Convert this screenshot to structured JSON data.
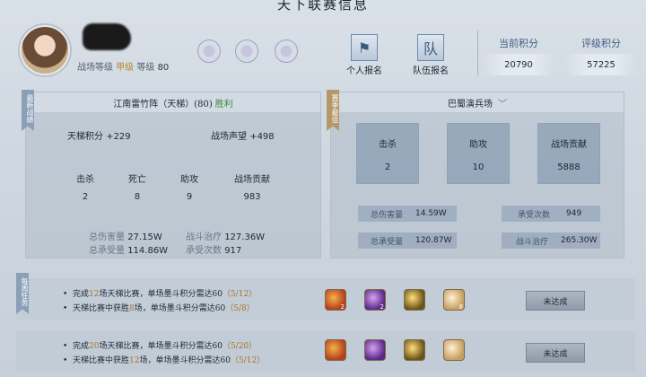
{
  "page_title": "天下联赛信息",
  "profile": {
    "level_label": "战场等级",
    "grade": "甲级",
    "level_word": "等级",
    "level": "80"
  },
  "actions": {
    "personal_signup": "个人报名",
    "team_signup": "队伍报名",
    "team_icon_char": "队"
  },
  "scores": {
    "current_label": "当前积分",
    "current_value": "20790",
    "rating_label": "评级积分",
    "rating_value": "57225"
  },
  "latest_battle": {
    "ribbon": "最新战绩",
    "title": "江南雷竹阵（天梯）(80)",
    "result": "胜利",
    "ladder_label": "天梯积分",
    "ladder_value": "+229",
    "prestige_label": "战场声望",
    "prestige_value": "+498",
    "stats": [
      {
        "label": "击杀",
        "value": "2"
      },
      {
        "label": "死亡",
        "value": "8"
      },
      {
        "label": "助攻",
        "value": "9"
      },
      {
        "label": "战场贡献",
        "value": "983"
      }
    ],
    "damage_label": "总伤害量",
    "damage_value": "27.15W",
    "heal_label": "战斗治疗",
    "heal_value": "127.36W",
    "taken_label": "总承受量",
    "taken_value": "114.86W",
    "hits_label": "承受次数",
    "hits_value": "917"
  },
  "season_best": {
    "ribbon": "赛季最佳",
    "map_name": "巴蜀演兵场",
    "cards": [
      {
        "label": "击杀",
        "value": "2"
      },
      {
        "label": "助攻",
        "value": "10"
      },
      {
        "label": "战场贡献",
        "value": "5888"
      }
    ],
    "damage_label": "总伤害量",
    "damage_value": "14.59W",
    "hits_label": "承受次数",
    "hits_value": "949",
    "taken_label": "总承受量",
    "taken_value": "120.87W",
    "heal_label": "战斗治疗",
    "heal_value": "265.30W"
  },
  "tasks": {
    "ribbon": "每周任务",
    "groups": [
      {
        "line1_pre": "完成",
        "line1_hl": "12",
        "line1_post": "场天梯比赛，单场墨斗积分需达60",
        "line1_progress": "（5/12）",
        "line2_pre": "天梯比赛中获胜",
        "line2_hl": "8",
        "line2_post": "场，单场墨斗积分需达60",
        "line2_progress": "（5/8）",
        "status": "未达成",
        "counts": [
          "2",
          "2",
          "",
          "8"
        ]
      },
      {
        "line1_pre": "完成",
        "line1_hl": "20",
        "line1_post": "场天梯比赛，单场墨斗积分需达60",
        "line1_progress": "（5/20）",
        "line2_pre": "天梯比赛中获胜",
        "line2_hl": "12",
        "line2_post": "场，单场墨斗积分需达60",
        "line2_progress": "（5/12）",
        "status": "未达成",
        "counts": [
          "",
          "",
          "",
          ""
        ]
      }
    ]
  }
}
